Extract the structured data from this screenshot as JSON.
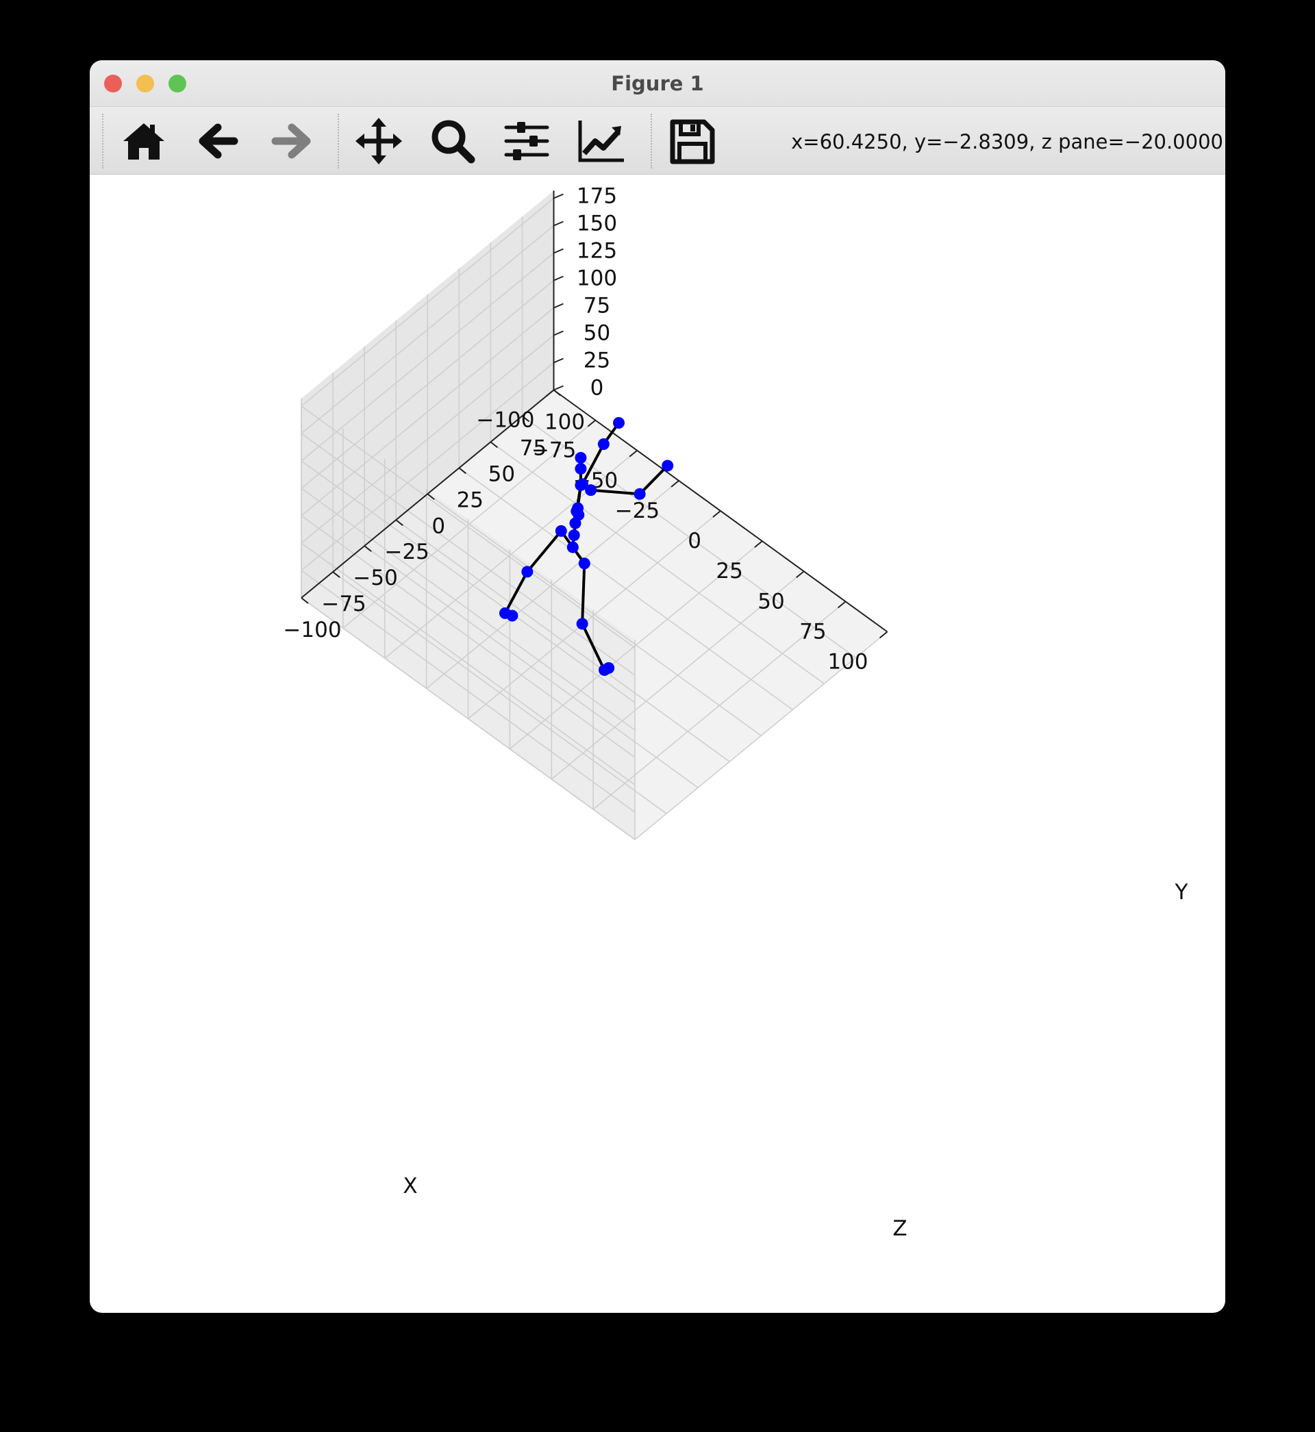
{
  "window": {
    "title": "Figure 1",
    "traffic_lights": [
      {
        "name": "close",
        "color": "#ec5f59"
      },
      {
        "name": "minimize",
        "color": "#f4bf4f"
      },
      {
        "name": "maximize",
        "color": "#5fc454"
      }
    ]
  },
  "toolbar": {
    "buttons": [
      {
        "name": "home",
        "icon": "home-icon",
        "enabled": true
      },
      {
        "name": "back",
        "icon": "arrow-left-icon",
        "enabled": true
      },
      {
        "name": "forward",
        "icon": "arrow-right-icon",
        "enabled": false
      },
      {
        "name": "pan",
        "icon": "move-arrows-icon",
        "enabled": true
      },
      {
        "name": "zoom",
        "icon": "magnifier-icon",
        "enabled": true
      },
      {
        "name": "configure-subplots",
        "icon": "sliders-icon",
        "enabled": true
      },
      {
        "name": "edit-axis",
        "icon": "line-chart-icon",
        "enabled": true
      },
      {
        "name": "save",
        "icon": "floppy-disk-icon",
        "enabled": true
      }
    ],
    "coordinates": "x=60.4250, y=−2.8309, z pane=−20.0000"
  },
  "chart_data": {
    "type": "scatter",
    "projection": "3d",
    "xlabel": "X",
    "ylabel": "Y",
    "zlabel": "Z",
    "xlim": [
      -100,
      100
    ],
    "ylim": [
      0,
      175
    ],
    "zlim": [
      -100,
      100
    ],
    "x_ticks": [
      "100",
      "75",
      "50",
      "25",
      "0",
      "−25",
      "−50",
      "−75",
      "−100"
    ],
    "y_ticks": [
      "0",
      "25",
      "50",
      "75",
      "100",
      "125",
      "150",
      "175"
    ],
    "z_ticks": [
      "−100",
      "−75",
      "−50",
      "−25",
      "0",
      "25",
      "50",
      "75",
      "100"
    ],
    "grid": true,
    "marker_color": "#0000ff",
    "line_color": "#000000",
    "joints": [
      {
        "name": "pelvis",
        "x": 6,
        "y": 92,
        "z": -25
      },
      {
        "name": "l_hip",
        "x": 16,
        "y": 92,
        "z": -29
      },
      {
        "name": "l_knee",
        "x": 20,
        "y": 48,
        "z": -36
      },
      {
        "name": "l_ankle",
        "x": 28,
        "y": 8,
        "z": -29
      },
      {
        "name": "l_toe",
        "x": 26,
        "y": 2,
        "z": -23
      },
      {
        "name": "r_hip",
        "x": -4,
        "y": 92,
        "z": -21
      },
      {
        "name": "r_knee",
        "x": -16,
        "y": 52,
        "z": -32
      },
      {
        "name": "r_ankle",
        "x": -24,
        "y": 12,
        "z": -39
      },
      {
        "name": "r_toe",
        "x": -25,
        "y": 2,
        "z": -32
      },
      {
        "name": "spine1",
        "x": 6,
        "y": 102,
        "z": -24
      },
      {
        "name": "spine2",
        "x": 6,
        "y": 112,
        "z": -23
      },
      {
        "name": "spine3",
        "x": 6,
        "y": 122,
        "z": -22
      },
      {
        "name": "neck",
        "x": 7,
        "y": 145,
        "z": -20
      },
      {
        "name": "head",
        "x": 7,
        "y": 160,
        "z": -20
      },
      {
        "name": "head_top",
        "x": 7,
        "y": 170,
        "z": -20
      },
      {
        "name": "l_shoulder",
        "x": 10,
        "y": 140,
        "z": -16
      },
      {
        "name": "l_elbow",
        "x": 25,
        "y": 135,
        "z": 3
      },
      {
        "name": "l_wrist",
        "x": 25,
        "y": 140,
        "z": 25
      },
      {
        "name": "r_shoulder",
        "x": 5,
        "y": 140,
        "z": -16
      },
      {
        "name": "r_elbow",
        "x": -5,
        "y": 137,
        "z": 14
      },
      {
        "name": "r_wrist",
        "x": -5,
        "y": 145,
        "z": 26
      },
      {
        "name": "r_hand1",
        "x": 9,
        "y": 131,
        "z": -25
      },
      {
        "name": "r_hand2",
        "x": 11,
        "y": 129,
        "z": -27
      }
    ],
    "bones": [
      [
        "pelvis",
        "l_hip"
      ],
      [
        "l_hip",
        "l_knee"
      ],
      [
        "l_knee",
        "l_ankle"
      ],
      [
        "l_ankle",
        "l_toe"
      ],
      [
        "pelvis",
        "r_hip"
      ],
      [
        "r_hip",
        "r_knee"
      ],
      [
        "r_knee",
        "r_ankle"
      ],
      [
        "r_ankle",
        "r_toe"
      ],
      [
        "pelvis",
        "spine1"
      ],
      [
        "spine1",
        "spine2"
      ],
      [
        "spine2",
        "spine3"
      ],
      [
        "spine3",
        "neck"
      ],
      [
        "neck",
        "head"
      ],
      [
        "head",
        "head_top"
      ],
      [
        "neck",
        "l_shoulder"
      ],
      [
        "l_shoulder",
        "l_elbow"
      ],
      [
        "l_elbow",
        "l_wrist"
      ],
      [
        "neck",
        "r_shoulder"
      ],
      [
        "r_shoulder",
        "r_elbow"
      ],
      [
        "r_elbow",
        "r_wrist"
      ],
      [
        "neck",
        "r_hand1"
      ],
      [
        "r_hand1",
        "r_hand2"
      ]
    ]
  }
}
